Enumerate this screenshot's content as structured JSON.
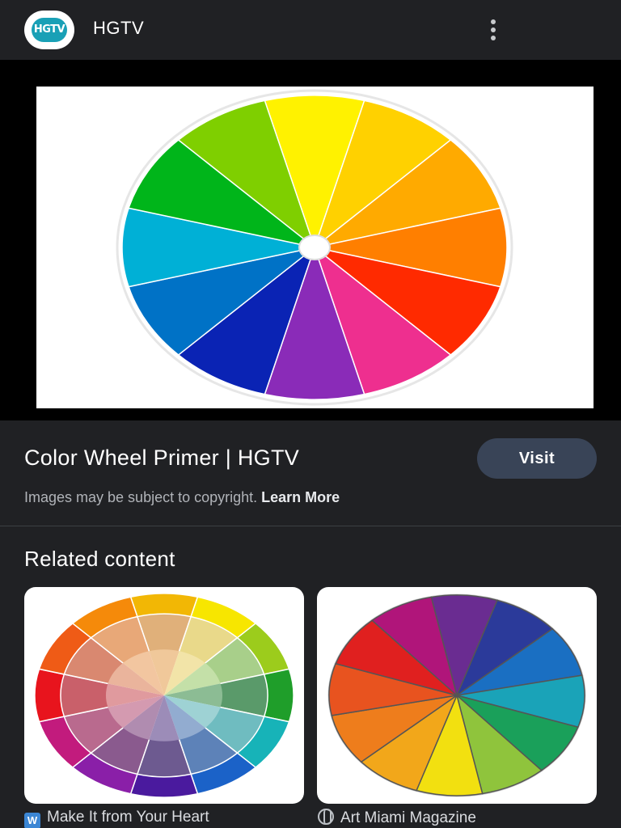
{
  "header": {
    "logo_text": "HGTV",
    "site_name": "HGTV",
    "menu_icon": "more-vert-icon"
  },
  "main_image": {
    "description_colors": [
      "#fff200",
      "#ffd100",
      "#ffaa00",
      "#ff7f00",
      "#ff2a00",
      "#ee2f8f",
      "#8a2bb8",
      "#0a23b4",
      "#0072c6",
      "#00b0d6",
      "#00b51a",
      "#7fcf00"
    ]
  },
  "result": {
    "title": "Color Wheel Primer | HGTV",
    "visit_label": "Visit",
    "copyright_text": "Images may be subject to copyright. ",
    "learn_more_label": "Learn More"
  },
  "related": {
    "heading": "Related content",
    "cards": [
      {
        "source": "Make It from Your Heart",
        "icon": "wordpress-icon"
      },
      {
        "source": "Art Miami Magazine",
        "icon": "globe-icon"
      }
    ]
  },
  "colors": {
    "background": "#202124",
    "visit_button": "#394457"
  }
}
